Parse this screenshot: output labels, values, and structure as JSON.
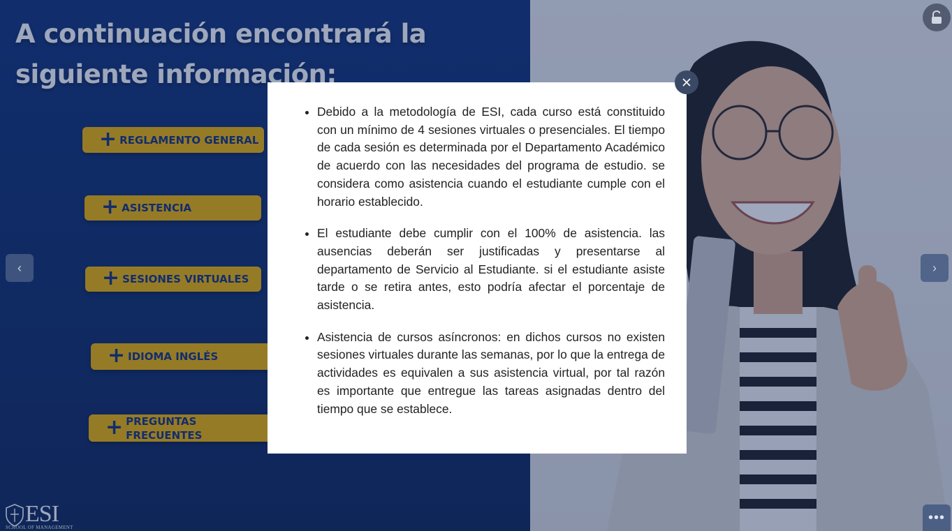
{
  "slide": {
    "title": "A continuación encontrará la siguiente información:",
    "menu": [
      {
        "label": "REGLAMENTO GENERAL"
      },
      {
        "label": "ASISTENCIA"
      },
      {
        "label": "SESIONES VIRTUALES"
      },
      {
        "label": "IDIOMA INGLÉS"
      },
      {
        "label": "PREGUNTAS FRECUENTES"
      }
    ],
    "logo": {
      "text": "ESI",
      "subtitle": "SCHOOL OF MANAGEMENT"
    },
    "colors": {
      "panel": "#0d2e78",
      "button": "#f2b300",
      "button_text": "#0d2e78"
    }
  },
  "modal": {
    "items": [
      "Debido a la metodología de ESI, cada curso está constituido con un mínimo de 4 sesiones  virtuales o presenciales. El tiempo de cada sesión es determinada por el Departamento Académico de acuerdo con las necesidades del programa de estudio. se considera como asistencia cuando el estudiante cumple con el horario establecido.",
      "El estudiante debe cumplir con el 100% de asistencia. las ausencias deberán ser justificadas y presentarse al departamento de Servicio al Estudiante. si el estudiante asiste tarde o se retira antes, esto podría afectar el porcentaje de asistencia.",
      "Asistencia de cursos asíncronos: en dichos cursos no existen sesiones virtuales durante las semanas, por lo que la entrega de actividades es equivalen a sus asistencia virtual, por tal razón es importante que entregue las tareas asignadas dentro del tiempo que se establece."
    ],
    "close_icon": "close-icon"
  },
  "controls": {
    "prev_icon": "‹",
    "next_icon": "›",
    "more_icon": "•••",
    "lock_icon": "unlock-icon"
  }
}
